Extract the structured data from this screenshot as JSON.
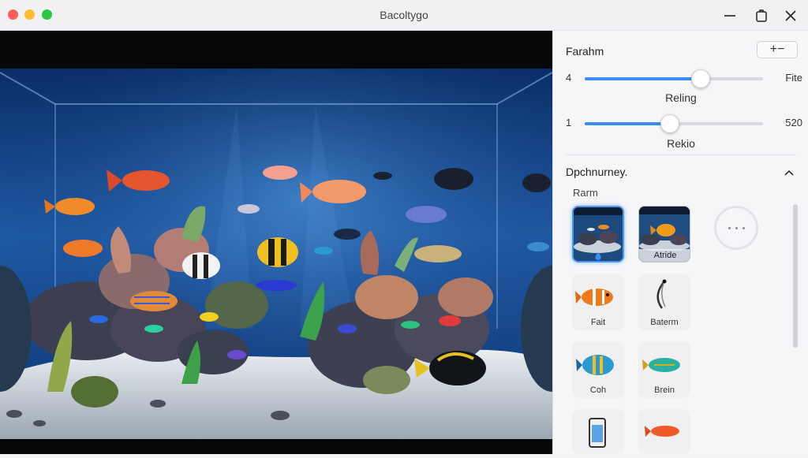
{
  "window": {
    "title": "Bacoltygo"
  },
  "panel": {
    "title": "Farahm",
    "add_remove_label": "+−",
    "sliders": [
      {
        "min_label": "4",
        "max_label": "Fite",
        "label": "Reling",
        "value_fraction": 0.65
      },
      {
        "min_label": "1",
        "max_label": "520",
        "label": "Rekio",
        "value_fraction": 0.48
      }
    ],
    "section": {
      "title": "Dpchnurney.",
      "subtitle": "Rarm",
      "tiles": [
        {
          "label": "",
          "kind": "tank-thumbnail",
          "selected": true,
          "icon": "water-drop-icon"
        },
        {
          "label": "Atride",
          "kind": "tank-thumbnail-fish",
          "selected": false
        },
        {
          "label": "Fait",
          "kind": "orange-clownfish"
        },
        {
          "label": "Baterm",
          "kind": "curved-stick"
        },
        {
          "label": "Coh",
          "kind": "blue-striped-fish"
        },
        {
          "label": "Brein",
          "kind": "teal-fish"
        },
        {
          "label": "",
          "kind": "phone-tank"
        },
        {
          "label": "",
          "kind": "red-fish"
        }
      ]
    }
  },
  "colors": {
    "accent": "#3a8df5",
    "window_bg": "#f4f4f6",
    "viewport_bg": "#050608",
    "water_deep": "#0b2f6a",
    "water_light": "#2f72c2"
  }
}
